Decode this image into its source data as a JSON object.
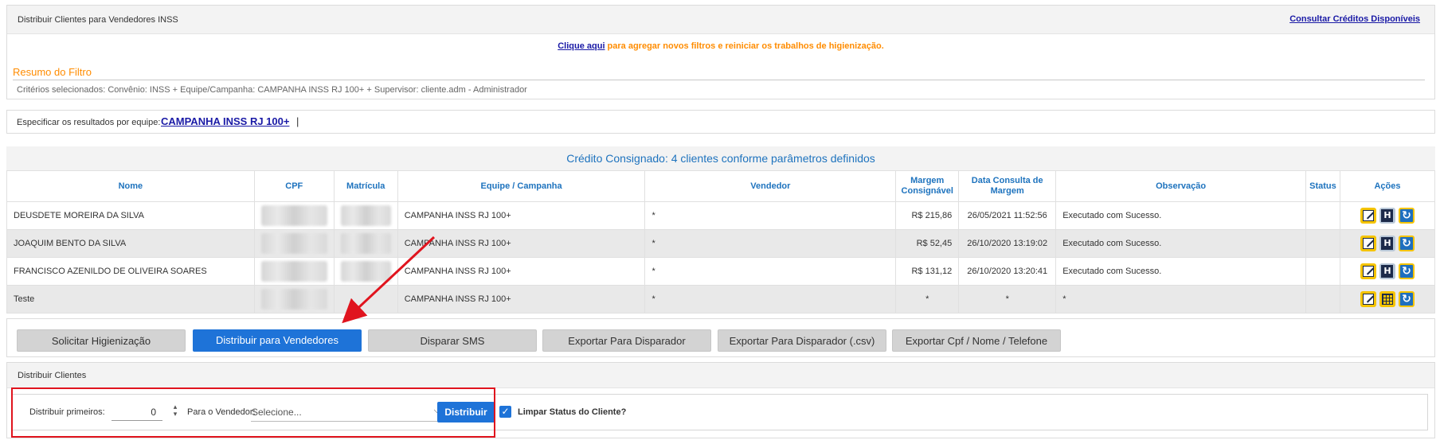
{
  "header": {
    "title": "Distribuir Clientes para Vendedores INSS",
    "credits_link": "Consultar Créditos Disponíveis"
  },
  "notice": {
    "link": "Clique aqui",
    "text": " para agregar novos filtros e reiniciar os trabalhos de higienização."
  },
  "filter_summary": {
    "title": "Resumo do Filtro",
    "criteria": "Critérios selecionados: Convênio: INSS + Equipe/Campanha: CAMPANHA INSS RJ 100+ + Supervisor: cliente.adm - Administrador"
  },
  "team_filter": {
    "label": "Especificar os resultados por equipe:",
    "campaign": "CAMPANHA INSS RJ 100+",
    "separator": "|"
  },
  "results": {
    "title": "Crédito Consignado: 4 clientes conforme parâmetros definidos",
    "columns": [
      "Nome",
      "CPF",
      "Matrícula",
      "Equipe / Campanha",
      "Vendedor",
      "Margem Consignável",
      "Data Consulta de Margem",
      "Observação",
      "Status",
      "Ações"
    ],
    "rows": [
      {
        "nome": "DEUSDETE MOREIRA DA SILVA",
        "equipe": "CAMPANHA INSS RJ 100+",
        "vendedor": "*",
        "margem": "R$ 215,86",
        "data": "26/05/2021 11:52:56",
        "obs": "Executado com Sucesso.",
        "status": ""
      },
      {
        "nome": "JOAQUIM BENTO DA SILVA",
        "equipe": "CAMPANHA INSS RJ 100+",
        "vendedor": "*",
        "margem": "R$ 52,45",
        "data": "26/10/2020 13:19:02",
        "obs": "Executado com Sucesso.",
        "status": ""
      },
      {
        "nome": "FRANCISCO AZENILDO DE OLIVEIRA SOARES",
        "equipe": "CAMPANHA INSS RJ 100+",
        "vendedor": "*",
        "margem": "R$ 131,12",
        "data": "26/10/2020 13:20:41",
        "obs": "Executado com Sucesso.",
        "status": ""
      },
      {
        "nome": "Teste",
        "equipe": "CAMPANHA INSS RJ 100+",
        "vendedor": "*",
        "margem": "*",
        "data": "*",
        "obs": "*",
        "status": ""
      }
    ],
    "row_actions": [
      [
        "edit-icon",
        "history-h-icon",
        "refresh-icon"
      ],
      [
        "edit-icon",
        "history-h-icon",
        "refresh-icon"
      ],
      [
        "edit-icon",
        "history-h-icon",
        "refresh-icon"
      ],
      [
        "edit-icon",
        "calculator-icon",
        "refresh-icon"
      ]
    ],
    "history_letter": "H"
  },
  "actions": {
    "solicitar": "Solicitar Higienização",
    "distribuir": "Distribuir para Vendedores",
    "sms": "Disparar SMS",
    "exportar": "Exportar Para Disparador",
    "exportar_csv": "Exportar Para Disparador (.csv)",
    "exportar_cpf": "Exportar Cpf / Nome / Telefone"
  },
  "distribute": {
    "title": "Distribuir Clientes",
    "first_label": "Distribuir primeiros:",
    "first_value": "0",
    "seller_label": "Para o Vendedor:",
    "seller_value": "Selecione...",
    "button": "Distribuir",
    "clear_status_label": "Limpar Status do Cliente?",
    "clear_status_checked": true
  },
  "colors": {
    "accent_blue": "#1e73d8",
    "header_blue": "#1e73be",
    "orange": "#ff8c00",
    "annotation_red": "#e0141e",
    "icon_yellow": "#f5c400"
  }
}
